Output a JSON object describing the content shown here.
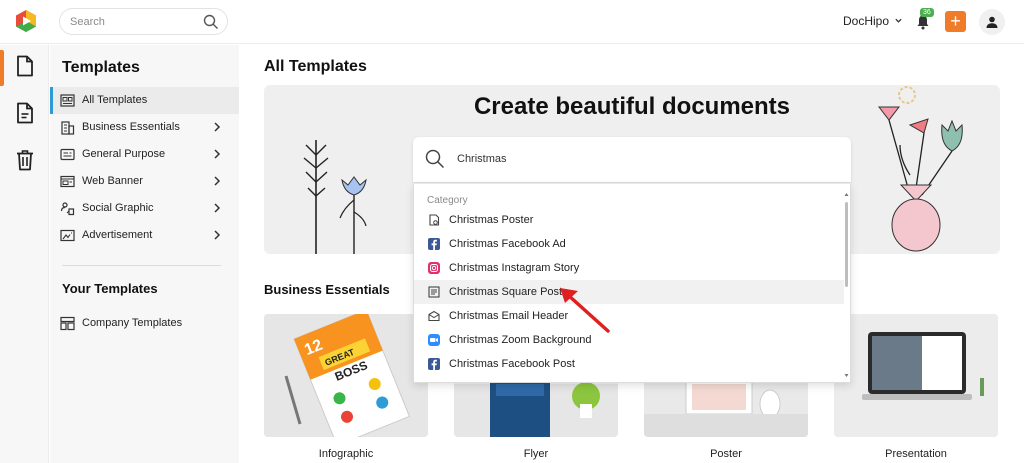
{
  "topbar": {
    "search_placeholder": "Search",
    "user_label": "DocHipo",
    "notification_count": "36",
    "plus_label": "+"
  },
  "rail": {
    "items": [
      {
        "icon": "document-icon",
        "active": true
      },
      {
        "icon": "text-document-icon",
        "active": false
      },
      {
        "icon": "trash-icon",
        "active": false
      }
    ]
  },
  "sidebar": {
    "title": "Templates",
    "items": [
      {
        "label": "All Templates",
        "icon": "grid-template-icon",
        "active": true
      },
      {
        "label": "Business Essentials",
        "icon": "building-icon"
      },
      {
        "label": "General Purpose",
        "icon": "general-purpose-icon"
      },
      {
        "label": "Web Banner",
        "icon": "web-banner-icon"
      },
      {
        "label": "Social Graphic",
        "icon": "social-graphic-icon"
      },
      {
        "label": "Advertisement",
        "icon": "advertisement-icon"
      }
    ],
    "your_templates_title": "Your Templates",
    "company_templates_label": "Company Templates"
  },
  "main": {
    "title": "All Templates",
    "hero_title": "Create beautiful documents",
    "section_title": "Business Essentials",
    "cards": [
      {
        "label": "Infographic"
      },
      {
        "label": "Flyer"
      },
      {
        "label": "Poster"
      },
      {
        "label": "Presentation"
      }
    ]
  },
  "search_panel": {
    "query": "Christmas",
    "category_heading": "Category",
    "results": [
      {
        "label": "Christmas Poster",
        "icon": "poster-icon"
      },
      {
        "label": "Christmas Facebook Ad",
        "icon": "facebook-icon",
        "color": "#3b5998"
      },
      {
        "label": "Christmas Instagram Story",
        "icon": "instagram-icon",
        "color": "#e1306c"
      },
      {
        "label": "Christmas Square Post",
        "icon": "square-post-icon",
        "highlighted": true
      },
      {
        "label": "Christmas Email Header",
        "icon": "email-icon"
      },
      {
        "label": "Christmas Zoom Background",
        "icon": "zoom-icon",
        "color": "#2d8cff"
      },
      {
        "label": "Christmas Facebook Post",
        "icon": "facebook-icon",
        "color": "#3b5998"
      }
    ]
  },
  "colors": {
    "accent_orange": "#f07c2a",
    "active_blue": "#2e9bd6",
    "badge_green": "#4caf50",
    "annotation_red": "#e02020"
  }
}
